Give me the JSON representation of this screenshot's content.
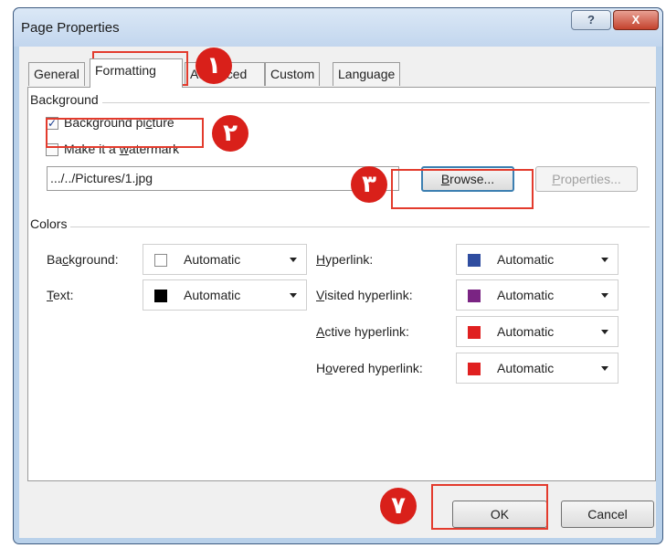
{
  "window": {
    "title": "Page Properties",
    "help_glyph": "?",
    "close_glyph": "X"
  },
  "tabs": [
    {
      "label": "General",
      "active": false
    },
    {
      "label": "Formatting",
      "active": true
    },
    {
      "label": "Advanced",
      "active": false
    },
    {
      "label": "Custom",
      "active": false
    },
    {
      "label": "Language",
      "active": false
    }
  ],
  "background_group": {
    "label": "Background",
    "background_picture": {
      "label": "Background picture",
      "checked": true,
      "check_glyph": "✓"
    },
    "watermark": {
      "label": "Make it a watermark",
      "checked": false
    },
    "path_value": ".../../Pictures/1.jpg",
    "browse_label": "Browse...",
    "properties_label": "Properties..."
  },
  "colors_group": {
    "label": "Colors",
    "background": {
      "label": "Background:",
      "value": "Automatic",
      "swatch": "#ffffff"
    },
    "text": {
      "label": "Text:",
      "value": "Automatic",
      "swatch": "#000000"
    },
    "hyperlink": {
      "label": "Hyperlink:",
      "value": "Automatic",
      "swatch": "#2f4da0"
    },
    "visited_hyperlink": {
      "label": "Visited hyperlink:",
      "value": "Automatic",
      "swatch": "#7a2483"
    },
    "active_hyperlink": {
      "label": "Active hyperlink:",
      "value": "Automatic",
      "swatch": "#e02020"
    },
    "hovered_hyperlink": {
      "label": "Hovered hyperlink:",
      "value": "Automatic",
      "swatch": "#e02020"
    }
  },
  "footer": {
    "ok_label": "OK",
    "cancel_label": "Cancel"
  },
  "annotations": {
    "step1": "١",
    "step2": "٢",
    "step3": "٣",
    "step7": "٧",
    "color": "#d9201a"
  }
}
